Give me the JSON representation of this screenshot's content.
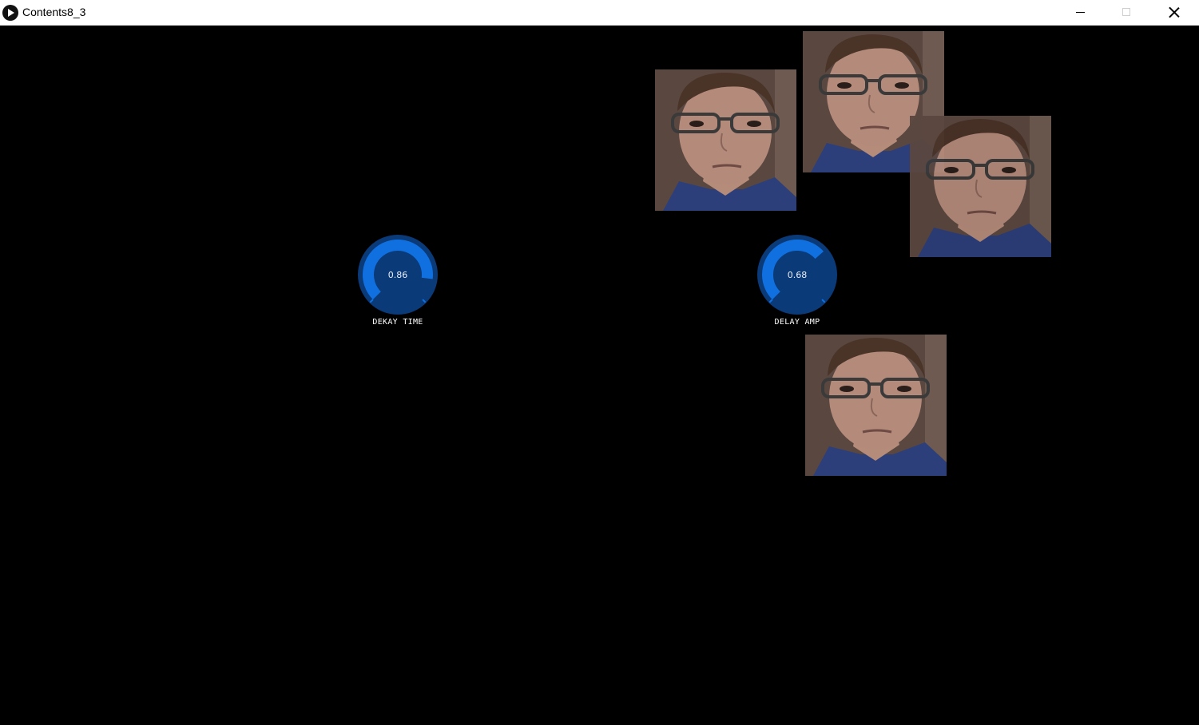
{
  "window": {
    "title": "Contents8_3",
    "controls": {
      "minimize": "minimize-icon",
      "maximize": "maximize-icon",
      "close": "close-icon"
    }
  },
  "knobs": [
    {
      "label": "DEKAY TIME",
      "value_text": "0.86",
      "value": 0.86
    },
    {
      "label": "DELAY AMP",
      "value_text": "0.68",
      "value": 0.68
    }
  ],
  "colors": {
    "background": "#000000",
    "knob_body": "#0a3a78",
    "knob_active": "#1070e0"
  }
}
